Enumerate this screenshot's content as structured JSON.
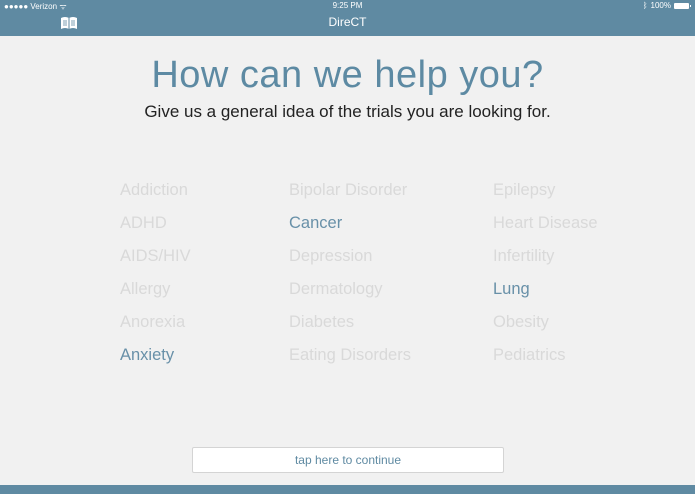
{
  "status_bar": {
    "carrier": "●●●●● Verizon",
    "time": "9:25 PM",
    "battery": "100%"
  },
  "app_title": "DireCT",
  "heading": "How can we help you?",
  "subheading": "Give us a general idea of the trials you are looking for.",
  "conditions": {
    "col1": [
      {
        "label": "Addiction",
        "selected": false
      },
      {
        "label": "ADHD",
        "selected": false
      },
      {
        "label": "AIDS/HIV",
        "selected": false
      },
      {
        "label": "Allergy",
        "selected": false
      },
      {
        "label": "Anorexia",
        "selected": false
      },
      {
        "label": "Anxiety",
        "selected": true
      }
    ],
    "col2": [
      {
        "label": "Bipolar Disorder",
        "selected": false
      },
      {
        "label": "Cancer",
        "selected": true
      },
      {
        "label": "Depression",
        "selected": false
      },
      {
        "label": "Dermatology",
        "selected": false
      },
      {
        "label": "Diabetes",
        "selected": false
      },
      {
        "label": "Eating Disorders",
        "selected": false
      }
    ],
    "col3": [
      {
        "label": "Epilepsy",
        "selected": false
      },
      {
        "label": "Heart Disease",
        "selected": false
      },
      {
        "label": "Infertility",
        "selected": false
      },
      {
        "label": "Lung",
        "selected": true
      },
      {
        "label": "Obesity",
        "selected": false
      },
      {
        "label": "Pediatrics",
        "selected": false
      }
    ]
  },
  "continue_button": "tap here to continue",
  "colors": {
    "accent": "#5f8aa2",
    "selected": "#6890a8",
    "unselected": "#d9d9d9",
    "background": "#f1f1f1"
  }
}
